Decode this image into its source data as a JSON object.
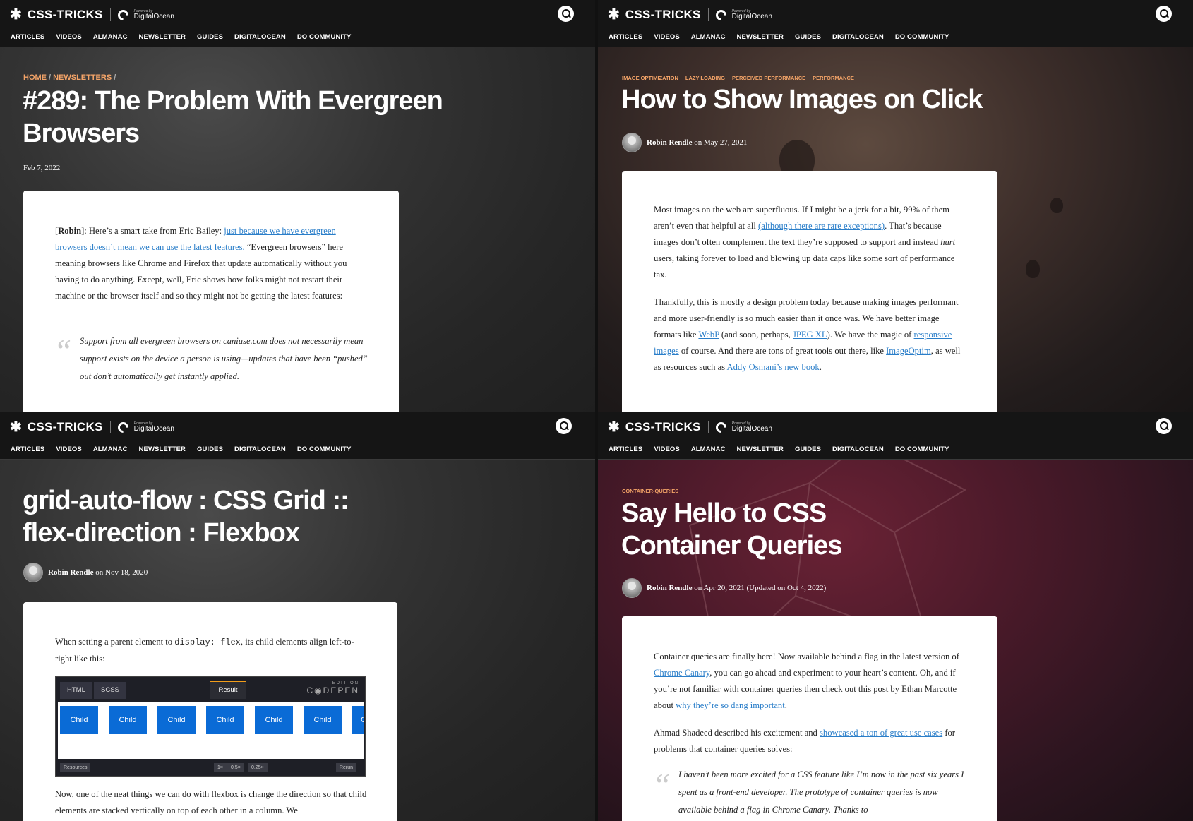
{
  "header": {
    "logo_star": "✱",
    "logo_text": "CSS-TRICKS",
    "sponsor_small": "Powered by",
    "sponsor_name": "DigitalOcean",
    "nav": [
      "ARTICLES",
      "VIDEOS",
      "ALMANAC",
      "NEWSLETTER",
      "GUIDES",
      "DIGITALOCEAN",
      "DO COMMUNITY"
    ],
    "search_icon": "search-icon"
  },
  "panel1": {
    "crumbs": [
      "HOME",
      "NEWSLETTERS"
    ],
    "crumb_sep": "/",
    "title_line1": "#289: The Problem With Evergreen",
    "title_line2": "Browsers",
    "date": "Feb 7, 2022",
    "p1_open": "[",
    "p1_author": "Robin",
    "p1_a": "]: Here’s a smart take from Eric Bailey: ",
    "p1_link": "just because we have evergreen browsers doesn’t mean we can use the latest features.",
    "p1_b": " “Evergreen browsers” here meaning browsers like Chrome and Firefox that update automatically without you having to do anything. Except, well, Eric shows how folks might not restart their machine or the browser itself and so they might not be getting the latest features:",
    "quote_mark": "“",
    "quote": "Support from all evergreen browsers on caniuse.com does not necessarily mean support exists on the device a person is using—updates that have been “pushed” out don’t automatically get instantly applied."
  },
  "panel2": {
    "tags": [
      "IMAGE OPTIMIZATION",
      "LAZY LOADING",
      "PERCEIVED PERFORMANCE",
      "PERFORMANCE"
    ],
    "title": "How to Show Images on Click",
    "author": "Robin Rendle",
    "on": " on ",
    "date": "May 27, 2021",
    "p1_a": "Most images on the web are superfluous. If I might be a jerk for a bit, 99% of them aren’t even that helpful at all ",
    "p1_link": "(although there are rare exceptions)",
    "p1_b": ". That’s because images don’t often complement the text they’re supposed to support and instead ",
    "p1_em": "hurt",
    "p1_c": " users, taking forever to load and blowing up data caps like some sort of performance tax.",
    "p2_a": "Thankfully, this is mostly a design problem today because making images performant and more user-friendly is so much easier than it once was. We have better image formats like ",
    "p2_webp": "WebP",
    "p2_b": " (and soon, perhaps, ",
    "p2_jpegxl": "JPEG XL",
    "p2_c": "). We have the magic of ",
    "p2_responsive": "responsive images",
    "p2_d": " of course. And there are tons of great tools out there, like ",
    "p2_imageoptim": "ImageOptim",
    "p2_e": ", as well as resources such as ",
    "p2_book": "Addy Osmani’s new book",
    "p2_f": "."
  },
  "panel3": {
    "title_line1": "grid-auto-flow : CSS Grid ::",
    "title_line2": "flex-direction : Flexbox",
    "author": "Robin Rendle",
    "on": " on ",
    "date": "Nov 18, 2020",
    "p1_a": "When setting a parent element to ",
    "p1_code": "display: flex",
    "p1_b": ", its child elements align left-to-right like this:",
    "codepen": {
      "tabs": [
        "HTML",
        "SCSS"
      ],
      "result": "Result",
      "edit_on": "EDIT ON",
      "brand": "C◉DEPEN",
      "children": [
        "Child",
        "Child",
        "Child",
        "Child",
        "Child",
        "Child",
        "C"
      ],
      "resources": "Resources",
      "zooms": [
        "1×",
        "0.5×",
        "0.25×"
      ],
      "rerun": "Rerun",
      "accent": "#0a6bd6"
    },
    "p2": "Now, one of the neat things we can do with flexbox is change the direction so that child elements are stacked vertically on top of each other in a column. We"
  },
  "panel4": {
    "tags": [
      "CONTAINER-QUERIES"
    ],
    "title_line1": "Say Hello to CSS",
    "title_line2": "Container Queries",
    "author": "Robin Rendle",
    "on": " on ",
    "date": "Apr 20, 2021 (Updated on Oct 4, 2022)",
    "p1_a": "Container queries are finally here! Now available behind a flag in the latest version of ",
    "p1_link": "Chrome Canary",
    "p1_b": ", you can go ahead and experiment to your heart’s content. Oh, and if you’re not familiar with container queries then check out this post by Ethan Marcotte about ",
    "p1_link2": "why they’re so dang important",
    "p1_c": ".",
    "p2_a": "Ahmad Shadeed described his excitement and ",
    "p2_link": "showcased a ton of great use cases",
    "p2_b": " for problems that container queries solves:",
    "quote_mark": "“",
    "quote": "I haven’t been more excited for a CSS feature like I’m now in the past six years I spent as a front-end developer. The prototype of container queries is now available behind a flag in Chrome Canary. Thanks to"
  },
  "colors": {
    "accent_orange": "#f4a468",
    "link_blue": "#2a7ec9"
  }
}
